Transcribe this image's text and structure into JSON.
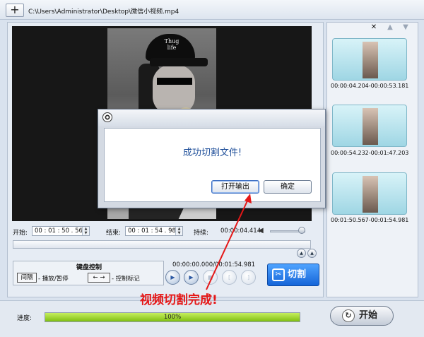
{
  "toolbar": {
    "add_label": "+",
    "file_path": "C:\\Users\\Administrator\\Desktop\\微信小视频.mp4"
  },
  "player": {
    "hat_text": "Thug life",
    "start_label": "开始:",
    "start_time": "00 : 01 : 50 . 567",
    "end_label": "结束:",
    "end_time": "00 : 01 : 54 . 981",
    "duration_label": "持续:",
    "duration_time": "00:00:04.414",
    "range_text": "00:00:00.000/00:01:54.981"
  },
  "keyboard": {
    "title": "键盘控制",
    "space_key": "间隔",
    "space_desc": "- 播放/暂停",
    "arrow_key": "← →",
    "arrow_desc": "- 控制标记"
  },
  "cut_button": {
    "label": "切割"
  },
  "clips": [
    {
      "time": "00:00:04.204-00:00:53.181"
    },
    {
      "time": "00:00:54.232-00:01:47.203"
    },
    {
      "time": "00:01:50.567-00:01:54.981"
    }
  ],
  "dialog": {
    "message": "成功切割文件!",
    "open_output": "打开输出",
    "ok": "确定"
  },
  "annotation": {
    "text": "视频切割完成!"
  },
  "progress": {
    "label": "进度:",
    "value": 100,
    "text": "100%"
  },
  "start_button": {
    "label": "开始"
  },
  "colors": {
    "accent": "#1565d8",
    "progress": "#7fbf12",
    "annotation": "#e51717"
  },
  "icons": {
    "add": "plus-icon",
    "close": "close-icon",
    "up": "arrow-up-icon",
    "down": "arrow-down-icon",
    "volume": "speaker-icon",
    "dialog": "reel-icon",
    "cut": "scissors-icon",
    "start": "refresh-icon"
  }
}
